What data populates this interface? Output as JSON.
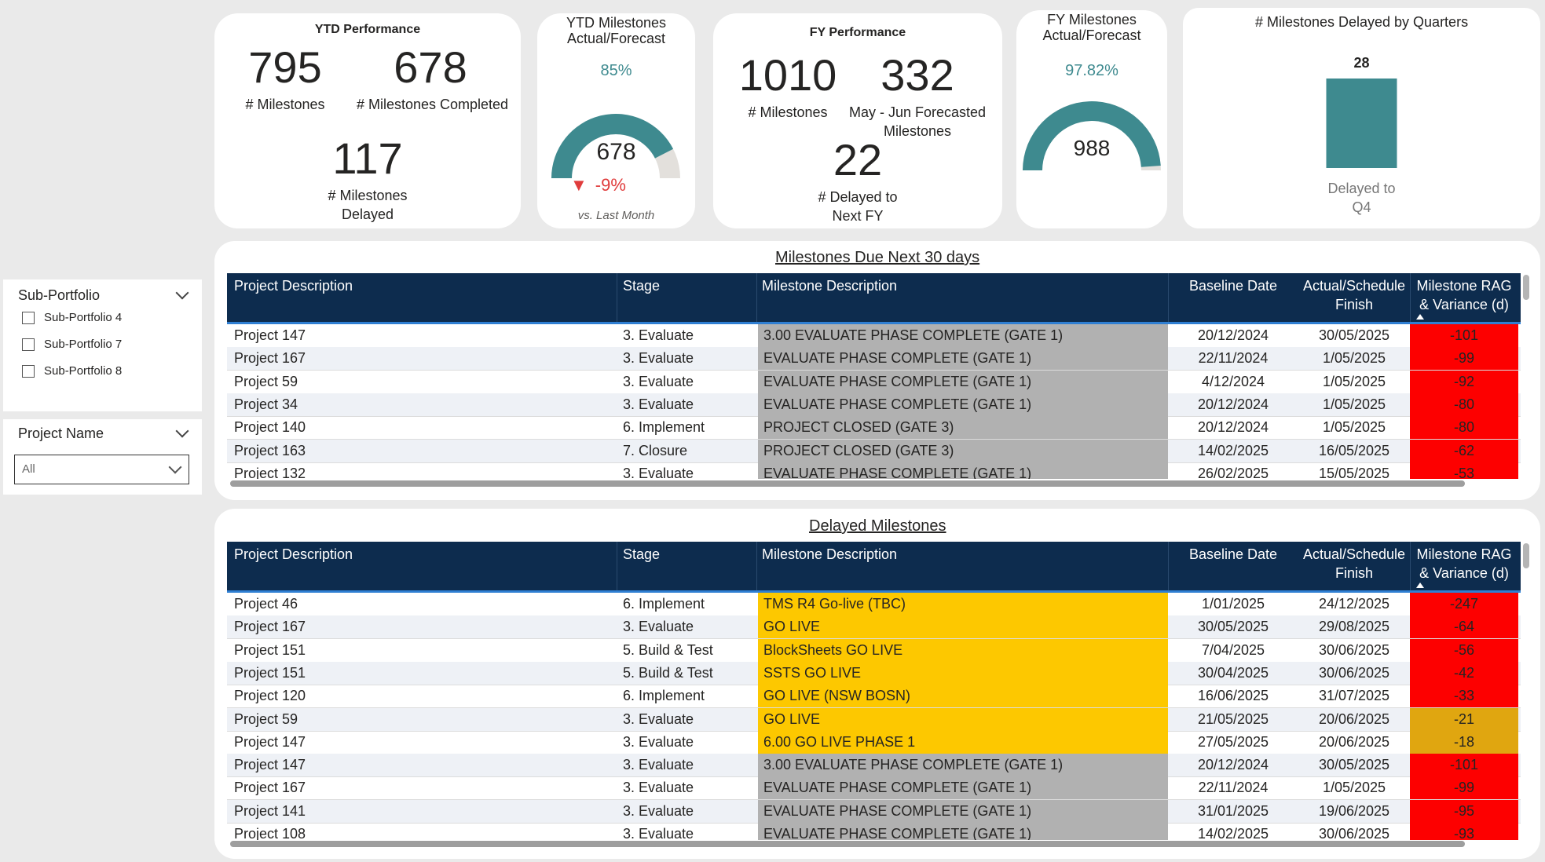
{
  "ytd_performance": {
    "title": "YTD Performance",
    "milestones_value": "795",
    "milestones_label": "# Milestones",
    "completed_value": "678",
    "completed_label": "# Milestones Completed",
    "delayed_value": "117",
    "delayed_label_1": "# Milestones",
    "delayed_label_2": "Delayed"
  },
  "ytd_gauge": {
    "title_1": "YTD Milestones",
    "title_2": "Actual/Forecast",
    "percent": "85%",
    "fill_fraction": 0.85,
    "value": "678",
    "delta_arrow": "▼",
    "delta": "-9%",
    "comparison": "vs. Last Month",
    "teal_color": "#3e8a8f",
    "red_color": "#e03c3c"
  },
  "fy_performance": {
    "title": "FY Performance",
    "milestones_value": "1010",
    "milestones_label": "# Milestones",
    "forecast_value": "332",
    "forecast_label_1": "May - Jun Forecasted",
    "forecast_label_2": "Milestones",
    "delayed_value": "22",
    "delayed_label_1": "# Delayed to",
    "delayed_label_2": "Next FY"
  },
  "fy_gauge": {
    "title_1": "FY Milestones",
    "title_2": "Actual/Forecast",
    "percent": "97.82%",
    "fill_fraction": 0.9782,
    "value": "988"
  },
  "quarters_chart": {
    "title": "# Milestones Delayed by Quarters",
    "bar_color": "#3e8a8f"
  },
  "chart_data": {
    "type": "bar",
    "categories": [
      "Delayed to Q4"
    ],
    "values": [
      28
    ],
    "title": "# Milestones Delayed by Quarters",
    "xlabel": "",
    "ylabel": ""
  },
  "slicers": {
    "sub_portfolio": {
      "title": "Sub-Portfolio",
      "items": [
        "Sub-Portfolio 4",
        "Sub-Portfolio 7",
        "Sub-Portfolio 8"
      ]
    },
    "project_name": {
      "title": "Project Name",
      "selected": "All"
    }
  },
  "columns": [
    "Project Description",
    "Stage",
    "Milestone Description",
    "Baseline Date",
    "Actual/Schedule Finish",
    "Milestone RAG & Variance (d)"
  ],
  "rag_colors": {
    "red": "#fd0000",
    "amber": "#e0a610",
    "milestone_grey": "#b1b1b1",
    "milestone_yellow": "#fdc800",
    "header_navy": "#0d2c4e"
  },
  "due_table": {
    "title": "Milestones Due Next 30 days",
    "rows": [
      {
        "project": "Project 147",
        "stage": "3. Evaluate",
        "milestone": "3.00 EVALUATE PHASE COMPLETE (GATE 1)",
        "baseline": "20/12/2024",
        "finish": "30/05/2025",
        "variance": "-101",
        "mcolor": "grey",
        "rag": "red"
      },
      {
        "project": "Project 167",
        "stage": "3. Evaluate",
        "milestone": "EVALUATE PHASE COMPLETE (GATE 1)",
        "baseline": "22/11/2024",
        "finish": "1/05/2025",
        "variance": "-99",
        "mcolor": "grey",
        "rag": "red"
      },
      {
        "project": "Project 59",
        "stage": "3. Evaluate",
        "milestone": "EVALUATE PHASE COMPLETE (GATE 1)",
        "baseline": "4/12/2024",
        "finish": "1/05/2025",
        "variance": "-92",
        "mcolor": "grey",
        "rag": "red"
      },
      {
        "project": "Project 34",
        "stage": "3. Evaluate",
        "milestone": "EVALUATE PHASE COMPLETE (GATE 1)",
        "baseline": "20/12/2024",
        "finish": "1/05/2025",
        "variance": "-80",
        "mcolor": "grey",
        "rag": "red"
      },
      {
        "project": "Project 140",
        "stage": "6. Implement",
        "milestone": "PROJECT CLOSED (GATE 3)",
        "baseline": "20/12/2024",
        "finish": "1/05/2025",
        "variance": "-80",
        "mcolor": "grey",
        "rag": "red"
      },
      {
        "project": "Project 163",
        "stage": "7. Closure",
        "milestone": "PROJECT CLOSED (GATE 3)",
        "baseline": "14/02/2025",
        "finish": "16/05/2025",
        "variance": "-62",
        "mcolor": "grey",
        "rag": "red"
      },
      {
        "project": "Project 132",
        "stage": "3. Evaluate",
        "milestone": "EVALUATE PHASE COMPLETE (GATE 1)",
        "baseline": "26/02/2025",
        "finish": "15/05/2025",
        "variance": "-53",
        "mcolor": "grey",
        "rag": "red"
      }
    ]
  },
  "delayed_table": {
    "title": "Delayed Milestones",
    "rows": [
      {
        "project": "Project 46",
        "stage": "6. Implement",
        "milestone": "TMS R4 Go-live (TBC)",
        "baseline": "1/01/2025",
        "finish": "24/12/2025",
        "variance": "-247",
        "mcolor": "yellow",
        "rag": "red"
      },
      {
        "project": "Project 167",
        "stage": "3. Evaluate",
        "milestone": "GO LIVE",
        "baseline": "30/05/2025",
        "finish": "29/08/2025",
        "variance": "-64",
        "mcolor": "yellow",
        "rag": "red"
      },
      {
        "project": "Project 151",
        "stage": "5. Build & Test",
        "milestone": "BlockSheets GO LIVE",
        "baseline": "7/04/2025",
        "finish": "30/06/2025",
        "variance": "-56",
        "mcolor": "yellow",
        "rag": "red"
      },
      {
        "project": "Project 151",
        "stage": "5. Build & Test",
        "milestone": "SSTS GO LIVE",
        "baseline": "30/04/2025",
        "finish": "30/06/2025",
        "variance": "-42",
        "mcolor": "yellow",
        "rag": "red"
      },
      {
        "project": "Project 120",
        "stage": "6. Implement",
        "milestone": "GO LIVE (NSW BOSN)",
        "baseline": "16/06/2025",
        "finish": "31/07/2025",
        "variance": "-33",
        "mcolor": "yellow",
        "rag": "red"
      },
      {
        "project": "Project 59",
        "stage": "3. Evaluate",
        "milestone": "GO LIVE",
        "baseline": "21/05/2025",
        "finish": "20/06/2025",
        "variance": "-21",
        "mcolor": "yellow",
        "rag": "amber"
      },
      {
        "project": "Project 147",
        "stage": "3. Evaluate",
        "milestone": "6.00 GO LIVE PHASE 1",
        "baseline": "27/05/2025",
        "finish": "20/06/2025",
        "variance": "-18",
        "mcolor": "yellow",
        "rag": "amber"
      },
      {
        "project": "Project 147",
        "stage": "3. Evaluate",
        "milestone": "3.00 EVALUATE PHASE COMPLETE (GATE 1)",
        "baseline": "20/12/2024",
        "finish": "30/05/2025",
        "variance": "-101",
        "mcolor": "grey",
        "rag": "red"
      },
      {
        "project": "Project 167",
        "stage": "3. Evaluate",
        "milestone": "EVALUATE PHASE COMPLETE (GATE 1)",
        "baseline": "22/11/2024",
        "finish": "1/05/2025",
        "variance": "-99",
        "mcolor": "grey",
        "rag": "red"
      },
      {
        "project": "Project 141",
        "stage": "3. Evaluate",
        "milestone": "EVALUATE PHASE COMPLETE (GATE 1)",
        "baseline": "31/01/2025",
        "finish": "19/06/2025",
        "variance": "-95",
        "mcolor": "grey",
        "rag": "red"
      },
      {
        "project": "Project 108",
        "stage": "3. Evaluate",
        "milestone": "EVALUATE PHASE COMPLETE (GATE 1)",
        "baseline": "14/02/2025",
        "finish": "30/06/2025",
        "variance": "-93",
        "mcolor": "grey",
        "rag": "red"
      }
    ]
  }
}
